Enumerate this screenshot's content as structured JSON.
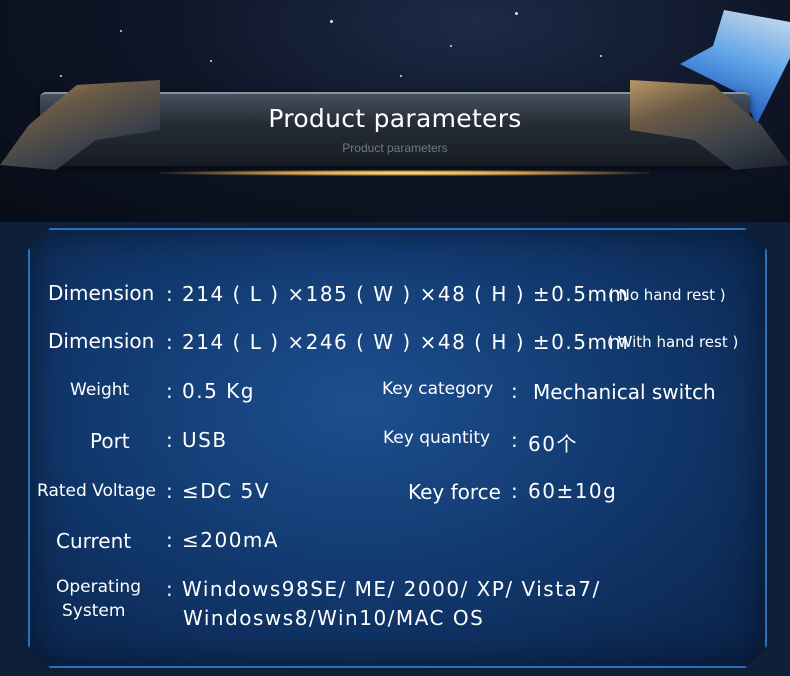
{
  "header": {
    "title": "Product parameters",
    "subtitle": "Product parameters"
  },
  "specs": {
    "dimension1": {
      "label": "Dimension",
      "colon": ":",
      "value": "214 ( L ) ×185 ( W ) ×48 ( H ) ±0.5mm",
      "note": "( No hand rest )"
    },
    "dimension2": {
      "label": "Dimension",
      "colon": ":",
      "value": "214 ( L ) ×246 ( W ) ×48 ( H ) ±0.5mm",
      "note": "( With hand rest )"
    },
    "weight": {
      "label": "Weight",
      "colon": ":",
      "value": "0.5 Kg"
    },
    "port": {
      "label": "Port",
      "colon": ":",
      "value": "USB"
    },
    "rated_voltage": {
      "label": "Rated Voltage",
      "colon": ":",
      "value": "≤DC 5V"
    },
    "current": {
      "label": "Current",
      "colon": ":",
      "value": "≤200mA"
    },
    "os": {
      "label_line1": "Operating",
      "label_line2": "System",
      "colon": ":",
      "value_line1": "Windows98SE/ ME/ 2000/ XP/ Vista7/",
      "value_line2": "Windosws8/Win10/MAC OS"
    },
    "key_category": {
      "label": "Key category",
      "colon": ":",
      "value": "Mechanical switch"
    },
    "key_quantity": {
      "label": "Key quantity",
      "colon": ":",
      "value": "60个"
    },
    "key_force": {
      "label": "Key force",
      "colon": ":",
      "value": "60±10g"
    }
  },
  "colors": {
    "panel": "#123a70",
    "border": "#2f6fb5",
    "text": "#ffffff",
    "glow": "#ffe7a3"
  }
}
